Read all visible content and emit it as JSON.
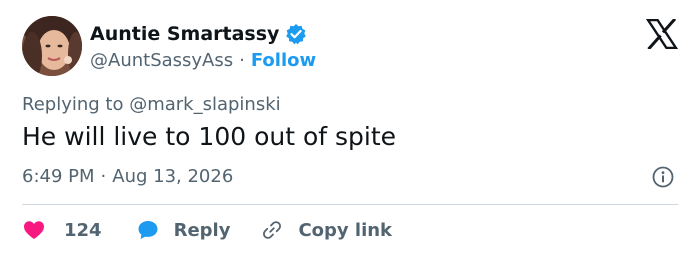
{
  "author": {
    "display_name": "Auntie Smartassy",
    "handle": "@AuntSassyAss",
    "separator": "·",
    "follow_label": "Follow"
  },
  "tweet": {
    "replying_to": "Replying to @mark_slapinski",
    "text": "He will live to 100 out of spite",
    "time": "6:49 PM",
    "separator": "·",
    "date": "Aug 13, 2026"
  },
  "actions": {
    "like_count": "124",
    "reply_label": "Reply",
    "copy_link_label": "Copy link"
  },
  "colors": {
    "accent": "#1d9bf0",
    "like": "#f91880",
    "text_primary": "#0f1419",
    "text_secondary": "#536471",
    "divider": "#cfd9de"
  },
  "icons": {
    "verified": "verified-badge-icon",
    "brand": "x-logo-icon",
    "info": "info-icon",
    "like": "heart-icon",
    "reply": "speech-bubble-icon",
    "copy": "link-icon"
  }
}
